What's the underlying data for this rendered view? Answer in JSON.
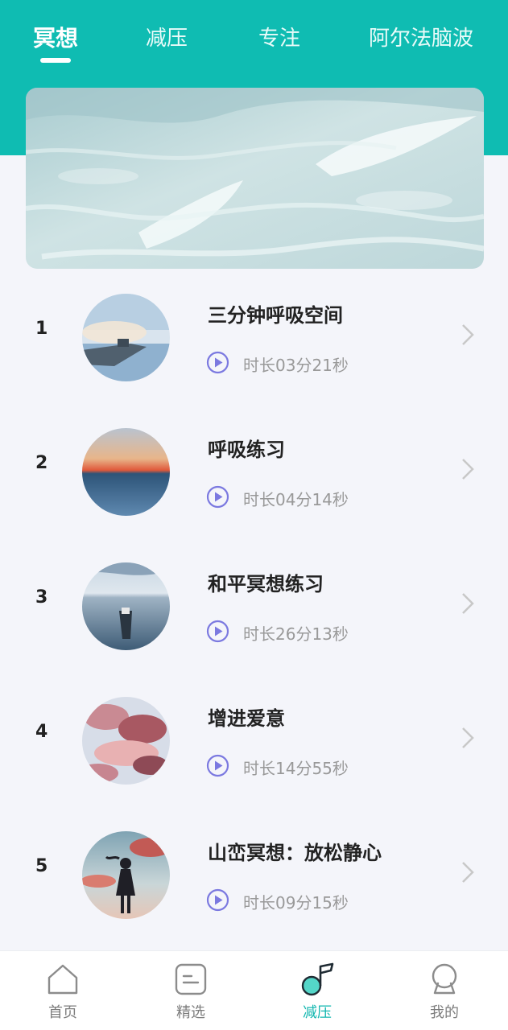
{
  "colors": {
    "accent": "#0fbcb2",
    "background": "#f4f5fa",
    "title_text": "#222222",
    "meta_text": "#999999",
    "play_icon": "#7b79e0",
    "nav_active": "#13b7b0",
    "nav_inactive": "#7d7d7d"
  },
  "tabs": [
    {
      "label": "冥想",
      "active": true
    },
    {
      "label": "减压",
      "active": false
    },
    {
      "label": "专注",
      "active": false
    },
    {
      "label": "阿尔法脑波",
      "active": false
    }
  ],
  "banner": {
    "image": "ocean-waves-photo"
  },
  "tracks": [
    {
      "rank": "1",
      "title": "三分钟呼吸空间",
      "duration": "时长03分21秒",
      "thumbnail": "misty-lake-photo",
      "play_icon": "play-circle-icon",
      "chevron_icon": "chevron-right-icon"
    },
    {
      "rank": "2",
      "title": "呼吸练习",
      "duration": "时长04分14秒",
      "thumbnail": "sunset-sea-photo",
      "play_icon": "play-circle-icon",
      "chevron_icon": "chevron-right-icon"
    },
    {
      "rank": "3",
      "title": "和平冥想练习",
      "duration": "时长26分13秒",
      "thumbnail": "boat-on-lake-photo",
      "play_icon": "play-circle-icon",
      "chevron_icon": "chevron-right-icon"
    },
    {
      "rank": "4",
      "title": "增进爱意",
      "duration": "时长14分55秒",
      "thumbnail": "pink-clouds-photo",
      "play_icon": "play-circle-icon",
      "chevron_icon": "chevron-right-icon"
    },
    {
      "rank": "5",
      "title": "山峦冥想：放松静心",
      "duration": "时长09分15秒",
      "thumbnail": "silhouette-girl-photo",
      "play_icon": "play-circle-icon",
      "chevron_icon": "chevron-right-icon"
    }
  ],
  "bottom_nav": [
    {
      "label": "首页",
      "icon": "home-icon",
      "active": false
    },
    {
      "label": "精选",
      "icon": "featured-icon",
      "active": false
    },
    {
      "label": "减压",
      "icon": "music-note-icon",
      "active": true
    },
    {
      "label": "我的",
      "icon": "profile-icon",
      "active": false
    }
  ]
}
